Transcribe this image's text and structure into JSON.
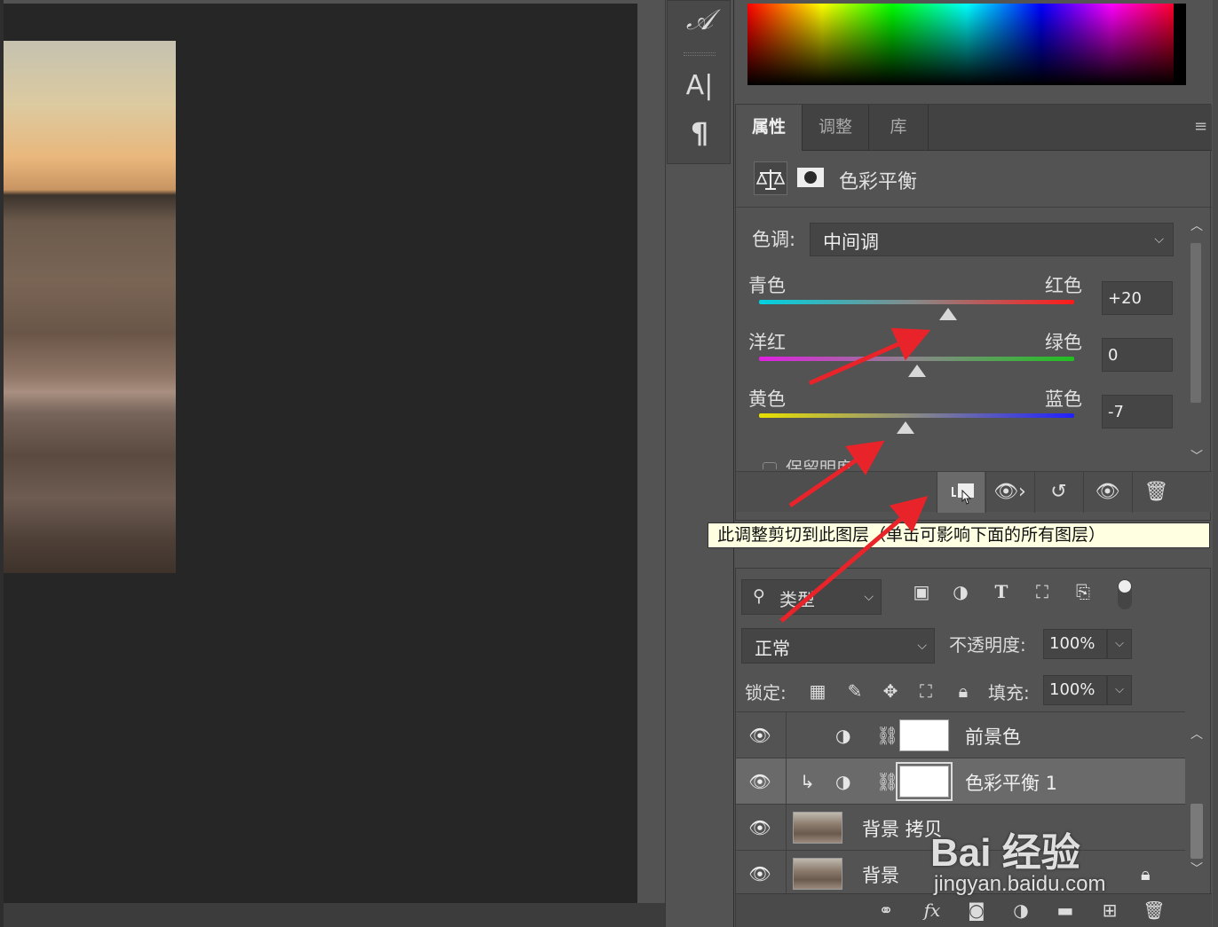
{
  "tool_strip": {
    "glyph_icon": "𝒜",
    "character_icon": "A|",
    "paragraph_icon": "¶"
  },
  "properties": {
    "tabs": [
      "属性",
      "调整",
      "库"
    ],
    "active_tab": "属性",
    "adjustment_title": "色彩平衡",
    "tone_label": "色调:",
    "tone_value": "中间调",
    "sliders": [
      {
        "left": "青色",
        "right": "红色",
        "value": "+20",
        "level": 20
      },
      {
        "left": "洋红",
        "right": "绿色",
        "value": "0",
        "level": 0
      },
      {
        "left": "黄色",
        "right": "蓝色",
        "value": "-7",
        "level": -7
      }
    ],
    "preserve_label": "保留明度",
    "slider_colors": {
      "cyan_red": [
        "#00d2e0",
        "#ff1a1a"
      ],
      "magenta_green": [
        "#e020e0",
        "#20c020"
      ],
      "yellow_blue": [
        "#e8e000",
        "#2020ff"
      ]
    }
  },
  "tooltip": "此调整剪切到此图层（单击可影响下面的所有图层）",
  "layers": {
    "filter_label": "类型",
    "blend_mode": "正常",
    "opacity_label": "不透明度:",
    "opacity_value": "100%",
    "lock_label": "锁定:",
    "fill_label": "填充:",
    "fill_value": "100%",
    "rows": [
      {
        "name": "前景色",
        "type": "fill"
      },
      {
        "name": "色彩平衡 1",
        "type": "adjustment",
        "clipped": true,
        "selected": true
      },
      {
        "name": "背景 拷贝",
        "type": "photo"
      },
      {
        "name": "背景",
        "type": "photo",
        "locked": true
      }
    ]
  },
  "watermark": {
    "main": "Bai 经验",
    "sub": "jingyan.baidu.com"
  },
  "colors": {
    "annotation_arrow": "#e8232a",
    "panel_bg": "#535353",
    "canvas_bg": "#262626",
    "tooltip_bg": "#ffffe1"
  }
}
